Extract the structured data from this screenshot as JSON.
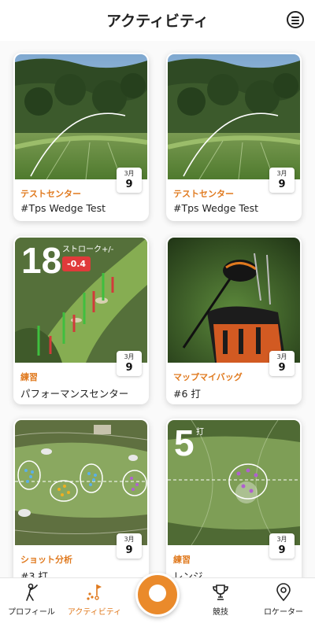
{
  "header": {
    "title": "アクティビティ",
    "menu_icon": "menu-circle-icon"
  },
  "cards": [
    {
      "category": "テストセンター",
      "subtitle": "#Tps Wedge Test",
      "month": "3月",
      "day": "9",
      "thumb": "shot-trace-forest"
    },
    {
      "category": "テストセンター",
      "subtitle": "#Tps Wedge Test",
      "month": "3月",
      "day": "9",
      "thumb": "shot-trace-forest"
    },
    {
      "category": "練習",
      "subtitle": "パフォーマンスセンター",
      "month": "3月",
      "day": "9",
      "thumb": "performance-green",
      "overlay": {
        "value": "18",
        "label": "ストローク+/-",
        "delta": "-0.4"
      }
    },
    {
      "category": "マップマイバッグ",
      "subtitle": "#6 打",
      "month": "3月",
      "day": "9",
      "thumb": "driver-bag"
    },
    {
      "category": "ショット分析",
      "subtitle": "#3 打",
      "month": "3月",
      "day": "9",
      "thumb": "shot-dispersion-map"
    },
    {
      "category": "練習",
      "subtitle": "レンジ",
      "month": "3月",
      "day": "9",
      "thumb": "range-dispersion",
      "overlay": {
        "value": "5",
        "label": "打"
      }
    }
  ],
  "tabbar": {
    "items": [
      {
        "label": "プロフィール",
        "icon": "golfer-icon"
      },
      {
        "label": "アクティビティ",
        "icon": "activity-flag-icon",
        "active": true
      },
      {
        "label": "",
        "icon": "golf-ball-icon"
      },
      {
        "label": "競技",
        "icon": "trophy-icon"
      },
      {
        "label": "ロケーター",
        "icon": "location-pin-icon"
      }
    ]
  },
  "colors": {
    "accent": "#e07a1f",
    "badge_red": "#e03a3a",
    "fab": "#ea8a2b"
  }
}
